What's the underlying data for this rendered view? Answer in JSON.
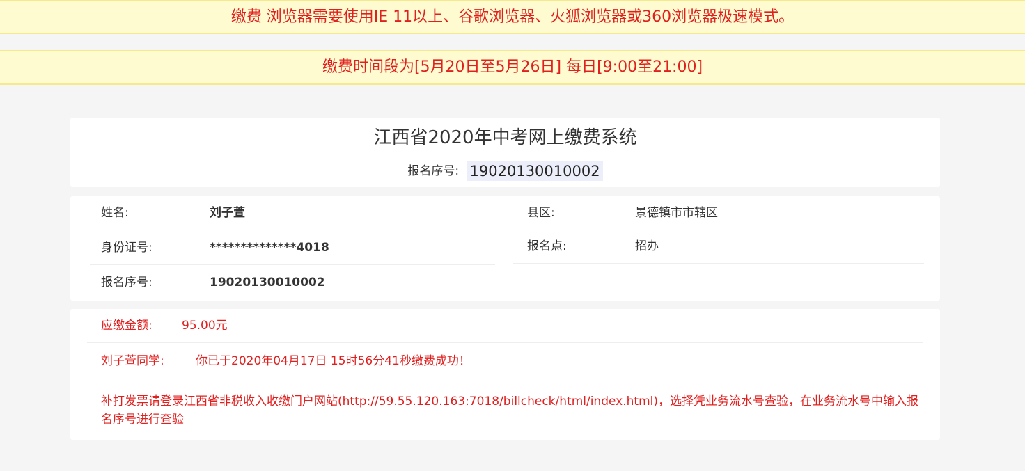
{
  "notices": {
    "browser": "缴费 浏览器需要使用IE 11以上、谷歌浏览器、火狐浏览器或360浏览器极速模式。",
    "period": "缴费时间段为[5月20日至5月26日] 每日[9:00至21:00]"
  },
  "header": {
    "title": "江西省2020年中考网上缴费系统",
    "serial_label": "报名序号:",
    "serial_value": "19020130010002"
  },
  "info": {
    "name_label": "姓名:",
    "name_value": "刘子萱",
    "id_label": "身份证号:",
    "id_value": "**************4018",
    "serial_label": "报名序号:",
    "serial_value": "19020130010002",
    "county_label": "县区:",
    "county_value": "景德镇市市辖区",
    "site_label": "报名点:",
    "site_value": "招办"
  },
  "payment": {
    "amount_label": "应缴金额:",
    "amount_value": "95.00元",
    "student_label": "刘子萱同学:",
    "status_message": "你已于2020年04月17日 15时56分41秒缴费成功！",
    "invoice_note": "补打发票请登录江西省非税收入收缴门户网站(http://59.55.120.163:7018/billcheck/html/index.html)，选择凭业务流水号查验，在业务流水号中输入报名序号进行查验"
  },
  "colors": {
    "notice_bg": "#fffbd1",
    "alert_red": "#e0201f",
    "page_bg": "#f5f5f5"
  }
}
